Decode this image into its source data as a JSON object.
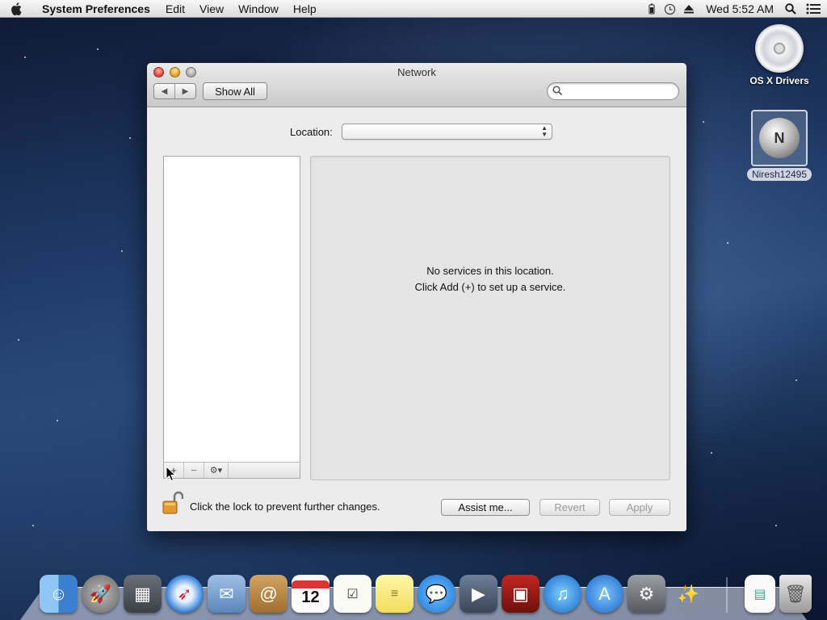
{
  "menubar": {
    "app_name": "System Preferences",
    "menus": [
      "Edit",
      "View",
      "Window",
      "Help"
    ],
    "clock": "Wed 5:52 AM"
  },
  "desktop": {
    "icons": [
      {
        "label": "OS X Drivers"
      },
      {
        "label": "Niresh12495",
        "glyph": "N"
      }
    ]
  },
  "window": {
    "title": "Network",
    "toolbar": {
      "back_glyph": "◀",
      "forward_glyph": "▶",
      "show_all_label": "Show All",
      "search_placeholder": "",
      "search_value": ""
    },
    "location": {
      "label": "Location:",
      "value": ""
    },
    "service_list": {
      "add_glyph": "+",
      "remove_glyph": "−",
      "gear_glyph": "⚙▾"
    },
    "detail": {
      "message_line1": "No services in this location.",
      "message_line2": "Click Add (+) to set up a service."
    },
    "footer": {
      "lock_text": "Click the lock to prevent further changes.",
      "assist_label": "Assist me...",
      "revert_label": "Revert",
      "apply_label": "Apply"
    }
  },
  "dock": {
    "apps": [
      "finder",
      "launchpad",
      "mission-control",
      "safari",
      "mail",
      "contacts",
      "calendar",
      "reminders",
      "notes",
      "messages",
      "facetime",
      "photo-booth",
      "itunes",
      "app-store",
      "system-preferences",
      "wizard"
    ],
    "calendar_day": "12",
    "others": [
      "document",
      "trash"
    ]
  }
}
